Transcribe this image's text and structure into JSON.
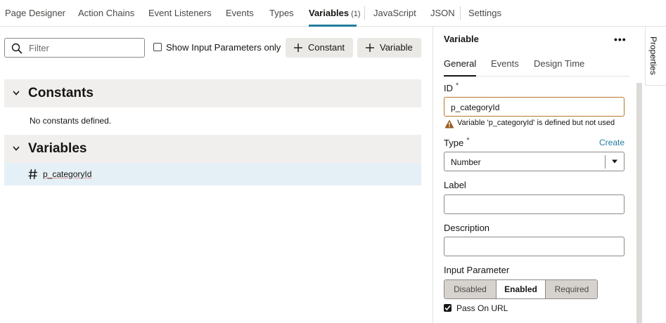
{
  "tabs": [
    {
      "label": "Page Designer"
    },
    {
      "label": "Action Chains"
    },
    {
      "label": "Event Listeners"
    },
    {
      "label": "Events"
    },
    {
      "label": "Types"
    },
    {
      "label": "Variables",
      "count": "(1)",
      "active": true
    },
    {
      "label": "JavaScript"
    },
    {
      "label": "JSON"
    },
    {
      "label": "Settings"
    }
  ],
  "toolbar": {
    "filter_placeholder": "Filter",
    "filter_value": "",
    "show_input_params_label": "Show Input Parameters only",
    "show_input_params_checked": false,
    "constant_button": "Constant",
    "variable_button": "Variable"
  },
  "constants": {
    "title": "Constants",
    "empty_text": "No constants defined."
  },
  "variables": {
    "title": "Variables",
    "items": [
      {
        "name": "p_categoryId",
        "type_icon": "number-hash-icon"
      }
    ]
  },
  "properties": {
    "title": "Variable",
    "more_label": "•••",
    "side_tab": "Properties",
    "tabs": [
      "General",
      "Events",
      "Design Time"
    ],
    "active_tab": "General",
    "id_label": "ID",
    "required_mark": "*",
    "id_value": "p_categoryId",
    "warning_text": "Variable 'p_categoryId' is defined but not used",
    "type_label": "Type",
    "create_link": "Create",
    "type_value": "Number",
    "label_label": "Label",
    "label_value": "",
    "description_label": "Description",
    "description_value": "",
    "input_parameter_label": "Input Parameter",
    "input_parameter_options": [
      "Disabled",
      "Enabled",
      "Required"
    ],
    "input_parameter_selected": "Enabled",
    "pass_on_url_label": "Pass On URL",
    "pass_on_url_checked": true
  },
  "colors": {
    "accent": "#227e9e",
    "warning": "#b37b28",
    "selected_row": "#e4f0f6",
    "section_bg": "#f1efed"
  }
}
